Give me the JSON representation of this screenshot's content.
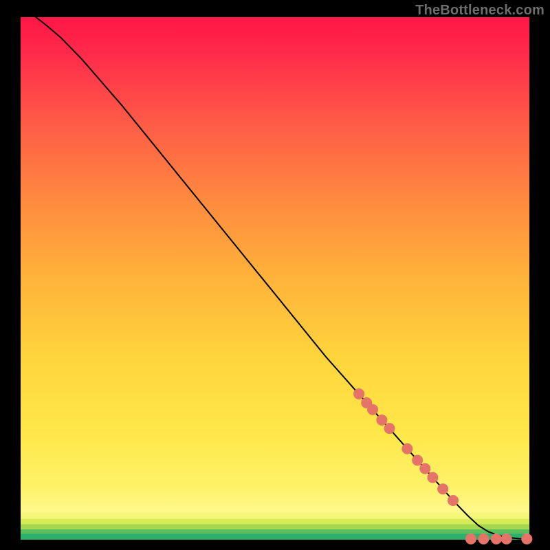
{
  "watermark": "TheBottleneck.com",
  "chart_data": {
    "type": "line",
    "title": "",
    "xlabel": "",
    "ylabel": "",
    "xlim": [
      0,
      100
    ],
    "ylim": [
      0,
      100
    ],
    "grid": false,
    "legend": false,
    "series": [
      {
        "name": "curve",
        "style": "line",
        "color": "#000000",
        "x": [
          3,
          5,
          8,
          12,
          16,
          20,
          25,
          30,
          35,
          40,
          45,
          50,
          55,
          60,
          65,
          70,
          75,
          80,
          85,
          88,
          90,
          92,
          94,
          96,
          98,
          100
        ],
        "y": [
          100,
          98.5,
          96.0,
          92.0,
          87.5,
          83.0,
          77.0,
          71.0,
          65.0,
          59.0,
          53.0,
          47.0,
          41.0,
          35.0,
          29.5,
          24.0,
          18.5,
          13.0,
          7.5,
          4.5,
          2.7,
          1.5,
          0.8,
          0.4,
          0.2,
          0.15
        ]
      },
      {
        "name": "markers-on-curve",
        "style": "markers",
        "color": "#e57368",
        "marker_radius": 8,
        "x": [
          66.5,
          68.0,
          69.2,
          71.0,
          72.5,
          76.0,
          78.0,
          79.5,
          81.0,
          83.0,
          85.0
        ],
        "y": [
          27.9,
          26.2,
          24.9,
          22.9,
          21.3,
          17.4,
          15.2,
          13.6,
          11.9,
          9.7,
          7.5
        ]
      },
      {
        "name": "markers-tail",
        "style": "markers",
        "color": "#e57368",
        "marker_radius": 8,
        "x": [
          88.5,
          91.0,
          93.5,
          95.5,
          99.5
        ],
        "y": [
          0.15,
          0.15,
          0.15,
          0.15,
          0.15
        ]
      }
    ],
    "bands": [
      {
        "y_from": 0.0,
        "y_to": 1.2,
        "color": "#2fb06a"
      },
      {
        "y_from": 1.2,
        "y_to": 2.0,
        "color": "#5bbf5e"
      },
      {
        "y_from": 2.0,
        "y_to": 3.0,
        "color": "#a4d94f"
      },
      {
        "y_from": 3.0,
        "y_to": 4.0,
        "color": "#d6eb55"
      },
      {
        "y_from": 4.0,
        "y_to": 5.2,
        "color": "#f4f77a"
      }
    ]
  }
}
